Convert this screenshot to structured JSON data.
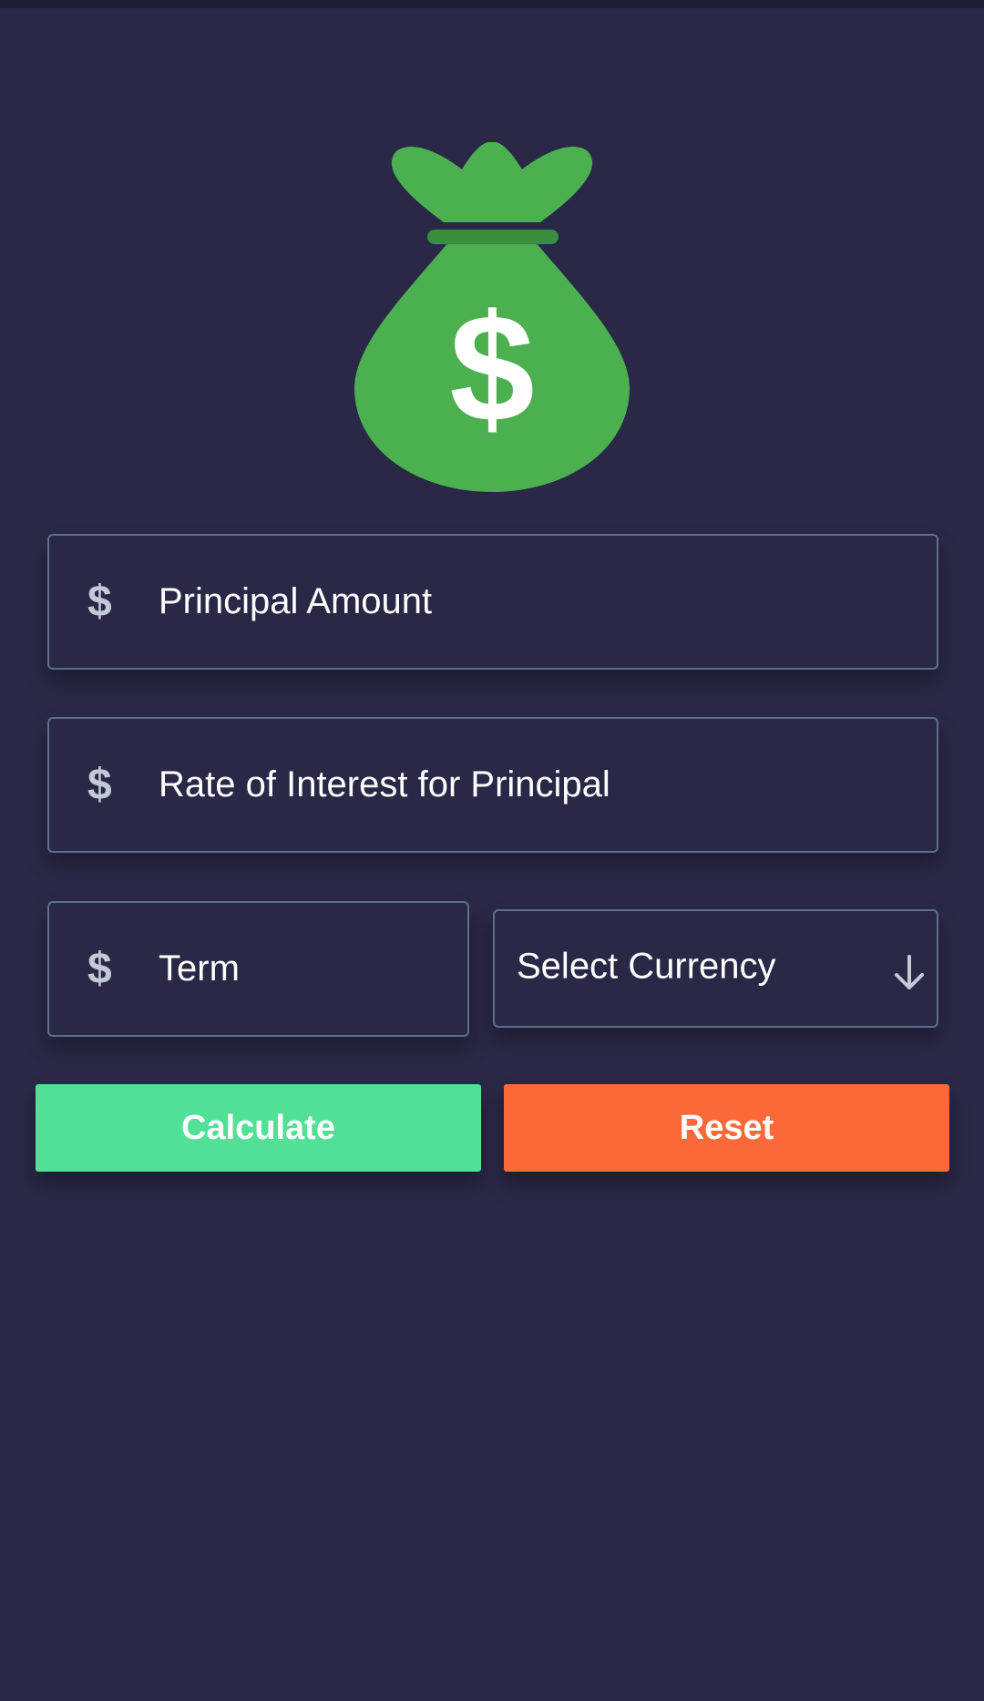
{
  "logo": {
    "icon": "money-bag-icon",
    "bag_color": "#4caf50",
    "tie_color": "#388e3c",
    "symbol": "$"
  },
  "form": {
    "principal": {
      "icon": "$",
      "placeholder": "Principal Amount"
    },
    "rate": {
      "icon": "$",
      "placeholder": "Rate of Interest for Principal"
    },
    "term": {
      "icon": "$",
      "placeholder": "Term"
    },
    "currency": {
      "label": "Select Currency",
      "icon": "arrow-down-icon"
    }
  },
  "buttons": {
    "calculate": {
      "label": "Calculate",
      "color": "#52df96"
    },
    "reset": {
      "label": "Reset",
      "color": "#fb6939"
    }
  },
  "theme": {
    "background": "#292846",
    "border": "#5d6f8a"
  }
}
